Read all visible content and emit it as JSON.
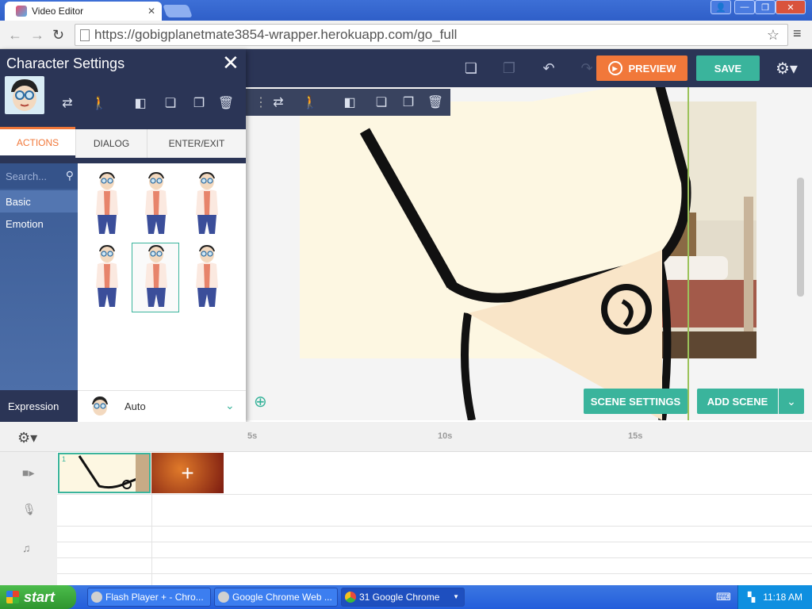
{
  "browser": {
    "tab_title": "Video Editor",
    "url": "https://gobigplanetmate3854-wrapper.herokuapp.com/go_full",
    "nav": {
      "back": "←",
      "forward": "→",
      "reload": "↻"
    }
  },
  "header": {
    "preview_label": "PREVIEW",
    "save_label": "SAVE"
  },
  "character_panel": {
    "title": "Character Settings",
    "tabs": [
      "ACTIONS",
      "DIALOG",
      "ENTER/EXIT"
    ],
    "search_placeholder": "Search...",
    "categories": [
      "Basic",
      "Emotion"
    ],
    "expression_label": "Expression",
    "expression_value": "Auto"
  },
  "stage": {
    "scene_settings_label": "SCENE SETTINGS",
    "add_scene_label": "ADD SCENE"
  },
  "timeline": {
    "ticks": [
      "5s",
      "10s",
      "15s"
    ],
    "clip_number": "1",
    "add_clip_symbol": "+"
  },
  "taskbar": {
    "start_label": "start",
    "tasks": [
      "Flash Player + - Chro...",
      "Google Chrome Web ...",
      "31 Google Chrome"
    ],
    "clock": "11:18 AM"
  },
  "colors": {
    "accent_orange": "#f1783a",
    "accent_teal": "#3ab49c",
    "navy": "#2b3556"
  }
}
